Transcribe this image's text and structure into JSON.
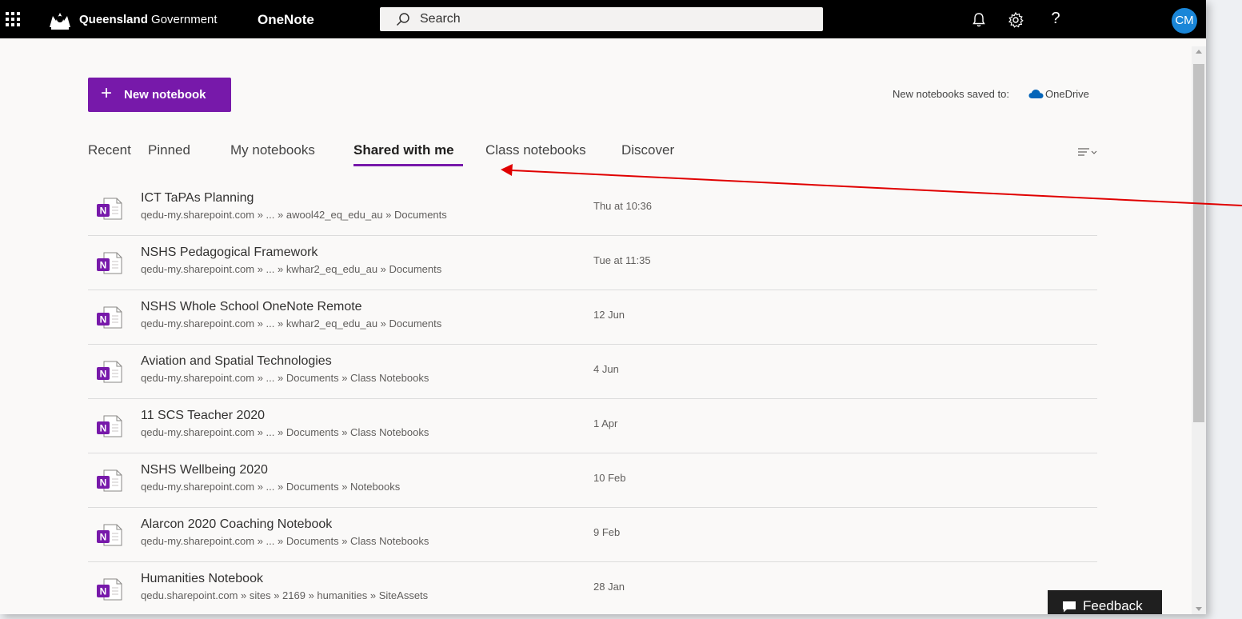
{
  "topbar": {
    "org_name_bold": "Queensland",
    "org_name_rest": " Government",
    "app_name": "OneNote",
    "search_placeholder": "Search",
    "help_glyph": "?",
    "avatar_initials": "CM",
    "icons": [
      "app-launcher-icon",
      "bell-icon",
      "gear-icon",
      "help-icon"
    ]
  },
  "toolbar": {
    "new_notebook_plus": "+",
    "new_notebook_label": "New notebook",
    "saved_to_label": "New notebooks saved to:",
    "saved_to_location": "OneDrive"
  },
  "tabs": [
    {
      "label": "Recent"
    },
    {
      "label": "Pinned"
    },
    {
      "label": "My notebooks"
    },
    {
      "label": "Shared with me",
      "active": true
    },
    {
      "label": "Class notebooks"
    },
    {
      "label": "Discover"
    }
  ],
  "notebooks": [
    {
      "title": "ICT TaPAs Planning",
      "path": "qedu-my.sharepoint.com » ... » awool42_eq_edu_au » Documents",
      "date": "Thu at 10:36"
    },
    {
      "title": "NSHS Pedagogical Framework",
      "path": "qedu-my.sharepoint.com » ... » kwhar2_eq_edu_au » Documents",
      "date": "Tue at 11:35"
    },
    {
      "title": "NSHS Whole School OneNote Remote",
      "path": "qedu-my.sharepoint.com » ... » kwhar2_eq_edu_au » Documents",
      "date": "12 Jun"
    },
    {
      "title": "Aviation and Spatial Technologies",
      "path": "qedu-my.sharepoint.com » ... » Documents » Class Notebooks",
      "date": "4 Jun"
    },
    {
      "title": "11 SCS Teacher 2020",
      "path": "qedu-my.sharepoint.com » ... » Documents » Class Notebooks",
      "date": "1 Apr"
    },
    {
      "title": "NSHS Wellbeing 2020",
      "path": "qedu-my.sharepoint.com » ... » Documents » Notebooks",
      "date": "10 Feb"
    },
    {
      "title": "Alarcon 2020 Coaching Notebook",
      "path": "qedu-my.sharepoint.com » ... » Documents » Class Notebooks",
      "date": "9 Feb"
    },
    {
      "title": "Humanities Notebook",
      "path": "qedu.sharepoint.com » sites » 2169 » humanities » SiteAssets",
      "date": "28 Jan"
    }
  ],
  "notebook_icon_letter": "N",
  "feedback_label": "Feedback",
  "colors": {
    "accent": "#7719aa",
    "topbar": "#000000",
    "avatar": "#1a86d8",
    "annotation_arrow": "#e00000"
  }
}
